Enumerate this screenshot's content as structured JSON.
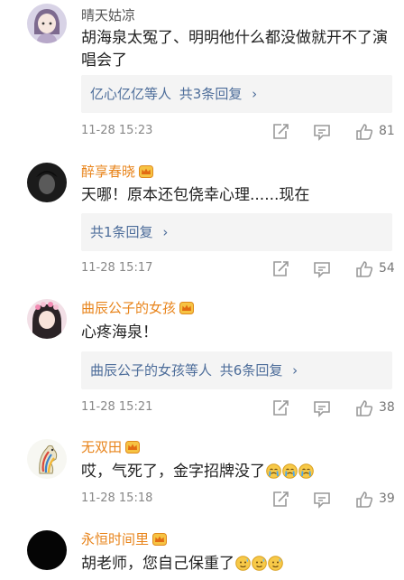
{
  "comments": [
    {
      "user": "晴天姑凉",
      "text": "胡海泉太冤了、明明他什么都没做就开不了演唱会了",
      "replies": {
        "names": "亿心亿亿等人",
        "count": "共3条回复"
      },
      "time": "11-28 15:23",
      "likes": "81"
    },
    {
      "user": "醉享春晓",
      "text": "天哪！原本还包侥幸心理......现在",
      "replies": {
        "names": "",
        "count": "共1条回复"
      },
      "time": "11-28 15:17",
      "likes": "54"
    },
    {
      "user": "曲辰公子的女孩",
      "text": "心疼海泉！",
      "replies": {
        "names": "曲辰公子的女孩等人",
        "count": "共6条回复"
      },
      "time": "11-28 15:21",
      "likes": "38"
    },
    {
      "user": "无双田",
      "text": "哎，气死了，金字招牌没了",
      "emojis": [
        "crying-emoji",
        "crying-emoji",
        "crying-emoji"
      ],
      "time": "11-28 15:18",
      "likes": "39"
    },
    {
      "user": "永恒时间里",
      "text": "胡老师，您自己保重了",
      "emojis": [
        "sweat-emoji",
        "sweat-emoji",
        "sweat-emoji"
      ]
    }
  ],
  "colors": {
    "vip_name": "#e8841b",
    "plain_name": "#555555",
    "reply_link": "#4d6d9a",
    "reply_bg": "#f4f4f4",
    "meta_gray": "#888888"
  }
}
